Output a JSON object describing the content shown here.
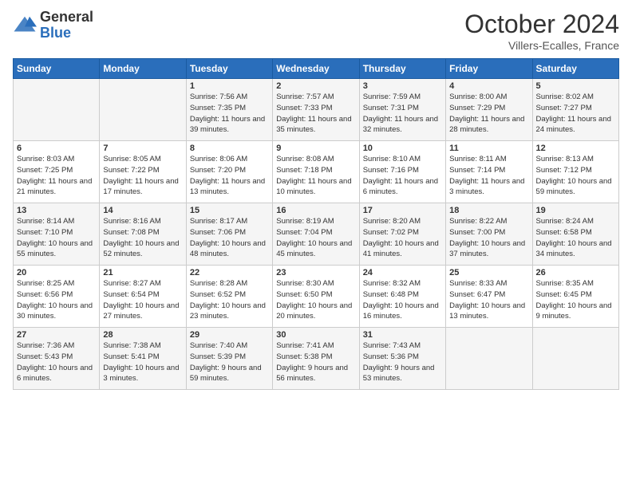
{
  "header": {
    "logo_general": "General",
    "logo_blue": "Blue",
    "title": "October 2024",
    "location": "Villers-Ecalles, France"
  },
  "days_of_week": [
    "Sunday",
    "Monday",
    "Tuesday",
    "Wednesday",
    "Thursday",
    "Friday",
    "Saturday"
  ],
  "weeks": [
    [
      {
        "day": "",
        "info": ""
      },
      {
        "day": "",
        "info": ""
      },
      {
        "day": "1",
        "info": "Sunrise: 7:56 AM\nSunset: 7:35 PM\nDaylight: 11 hours and 39 minutes."
      },
      {
        "day": "2",
        "info": "Sunrise: 7:57 AM\nSunset: 7:33 PM\nDaylight: 11 hours and 35 minutes."
      },
      {
        "day": "3",
        "info": "Sunrise: 7:59 AM\nSunset: 7:31 PM\nDaylight: 11 hours and 32 minutes."
      },
      {
        "day": "4",
        "info": "Sunrise: 8:00 AM\nSunset: 7:29 PM\nDaylight: 11 hours and 28 minutes."
      },
      {
        "day": "5",
        "info": "Sunrise: 8:02 AM\nSunset: 7:27 PM\nDaylight: 11 hours and 24 minutes."
      }
    ],
    [
      {
        "day": "6",
        "info": "Sunrise: 8:03 AM\nSunset: 7:25 PM\nDaylight: 11 hours and 21 minutes."
      },
      {
        "day": "7",
        "info": "Sunrise: 8:05 AM\nSunset: 7:22 PM\nDaylight: 11 hours and 17 minutes."
      },
      {
        "day": "8",
        "info": "Sunrise: 8:06 AM\nSunset: 7:20 PM\nDaylight: 11 hours and 13 minutes."
      },
      {
        "day": "9",
        "info": "Sunrise: 8:08 AM\nSunset: 7:18 PM\nDaylight: 11 hours and 10 minutes."
      },
      {
        "day": "10",
        "info": "Sunrise: 8:10 AM\nSunset: 7:16 PM\nDaylight: 11 hours and 6 minutes."
      },
      {
        "day": "11",
        "info": "Sunrise: 8:11 AM\nSunset: 7:14 PM\nDaylight: 11 hours and 3 minutes."
      },
      {
        "day": "12",
        "info": "Sunrise: 8:13 AM\nSunset: 7:12 PM\nDaylight: 10 hours and 59 minutes."
      }
    ],
    [
      {
        "day": "13",
        "info": "Sunrise: 8:14 AM\nSunset: 7:10 PM\nDaylight: 10 hours and 55 minutes."
      },
      {
        "day": "14",
        "info": "Sunrise: 8:16 AM\nSunset: 7:08 PM\nDaylight: 10 hours and 52 minutes."
      },
      {
        "day": "15",
        "info": "Sunrise: 8:17 AM\nSunset: 7:06 PM\nDaylight: 10 hours and 48 minutes."
      },
      {
        "day": "16",
        "info": "Sunrise: 8:19 AM\nSunset: 7:04 PM\nDaylight: 10 hours and 45 minutes."
      },
      {
        "day": "17",
        "info": "Sunrise: 8:20 AM\nSunset: 7:02 PM\nDaylight: 10 hours and 41 minutes."
      },
      {
        "day": "18",
        "info": "Sunrise: 8:22 AM\nSunset: 7:00 PM\nDaylight: 10 hours and 37 minutes."
      },
      {
        "day": "19",
        "info": "Sunrise: 8:24 AM\nSunset: 6:58 PM\nDaylight: 10 hours and 34 minutes."
      }
    ],
    [
      {
        "day": "20",
        "info": "Sunrise: 8:25 AM\nSunset: 6:56 PM\nDaylight: 10 hours and 30 minutes."
      },
      {
        "day": "21",
        "info": "Sunrise: 8:27 AM\nSunset: 6:54 PM\nDaylight: 10 hours and 27 minutes."
      },
      {
        "day": "22",
        "info": "Sunrise: 8:28 AM\nSunset: 6:52 PM\nDaylight: 10 hours and 23 minutes."
      },
      {
        "day": "23",
        "info": "Sunrise: 8:30 AM\nSunset: 6:50 PM\nDaylight: 10 hours and 20 minutes."
      },
      {
        "day": "24",
        "info": "Sunrise: 8:32 AM\nSunset: 6:48 PM\nDaylight: 10 hours and 16 minutes."
      },
      {
        "day": "25",
        "info": "Sunrise: 8:33 AM\nSunset: 6:47 PM\nDaylight: 10 hours and 13 minutes."
      },
      {
        "day": "26",
        "info": "Sunrise: 8:35 AM\nSunset: 6:45 PM\nDaylight: 10 hours and 9 minutes."
      }
    ],
    [
      {
        "day": "27",
        "info": "Sunrise: 7:36 AM\nSunset: 5:43 PM\nDaylight: 10 hours and 6 minutes."
      },
      {
        "day": "28",
        "info": "Sunrise: 7:38 AM\nSunset: 5:41 PM\nDaylight: 10 hours and 3 minutes."
      },
      {
        "day": "29",
        "info": "Sunrise: 7:40 AM\nSunset: 5:39 PM\nDaylight: 9 hours and 59 minutes."
      },
      {
        "day": "30",
        "info": "Sunrise: 7:41 AM\nSunset: 5:38 PM\nDaylight: 9 hours and 56 minutes."
      },
      {
        "day": "31",
        "info": "Sunrise: 7:43 AM\nSunset: 5:36 PM\nDaylight: 9 hours and 53 minutes."
      },
      {
        "day": "",
        "info": ""
      },
      {
        "day": "",
        "info": ""
      }
    ]
  ]
}
